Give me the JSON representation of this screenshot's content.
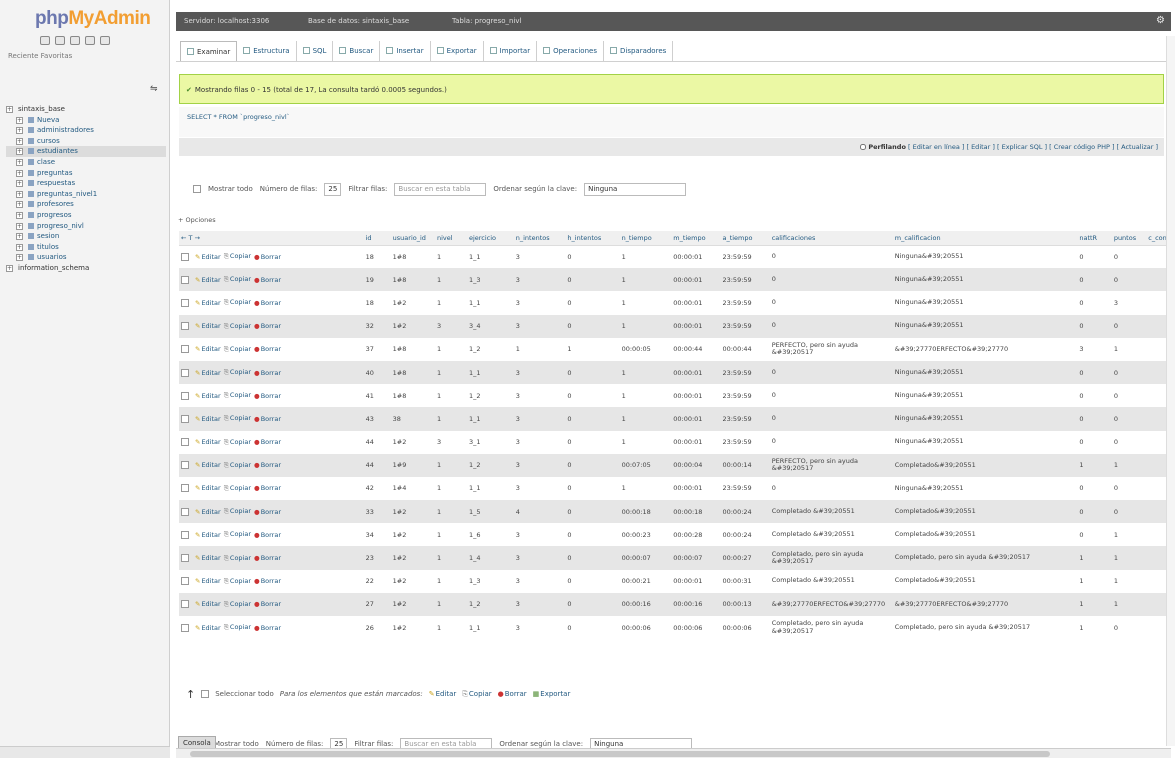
{
  "nav": {
    "logo_php": "php",
    "logo_my": "MyAdmin",
    "recent_label": "Reciente   Favoritas",
    "collapse_icon": "link-icon",
    "tree": [
      {
        "label": "sintaxis_base",
        "kind": "db",
        "selected": false
      },
      {
        "label": "Nueva",
        "kind": "tbl",
        "selected": false
      },
      {
        "label": "administradores",
        "kind": "tbl",
        "selected": false
      },
      {
        "label": "cursos",
        "kind": "tbl",
        "selected": false
      },
      {
        "label": "estudiantes",
        "kind": "tbl",
        "selected": true
      },
      {
        "label": "clase",
        "kind": "tbl",
        "selected": false
      },
      {
        "label": "preguntas",
        "kind": "tbl",
        "selected": false
      },
      {
        "label": "respuestas",
        "kind": "tbl",
        "selected": false
      },
      {
        "label": "preguntas_nivel1",
        "kind": "tbl",
        "selected": false
      },
      {
        "label": "profesores",
        "kind": "tbl",
        "selected": false
      },
      {
        "label": "progresos",
        "kind": "tbl",
        "selected": false
      },
      {
        "label": "progreso_nivl",
        "kind": "tbl",
        "selected": false
      },
      {
        "label": "sesion",
        "kind": "tbl",
        "selected": false
      },
      {
        "label": "titulos",
        "kind": "tbl",
        "selected": false
      },
      {
        "label": "usuarios",
        "kind": "tbl",
        "selected": false
      },
      {
        "label": "information_schema",
        "kind": "db",
        "selected": false
      }
    ]
  },
  "topbar": {
    "crumbs": [
      "Servidor: localhost:3306",
      "Base de datos: sintaxis_base",
      "Tabla: progreso_nivl"
    ],
    "gear_icon": "gear-icon"
  },
  "tabs": [
    "Examinar",
    "Estructura",
    "SQL",
    "Buscar",
    "Insertar",
    "Exportar",
    "Importar",
    "Operaciones",
    "Disparadores"
  ],
  "success_message": "Mostrando filas 0 - 15 (total de 17, La consulta tardó 0.0005 segundos.)",
  "sql_query": "SELECT * FROM `progreso_nivl`",
  "profiling": {
    "label": "Perfilando",
    "links": "[ Editar en línea ] [ Editar ] [ Explicar SQL ] [ Crear código PHP ] [ Actualizar ]"
  },
  "toolbar": {
    "show_all": "Mostrar todo",
    "rows_label": "Número de filas:",
    "rows_value": "25",
    "filter_label": "Filtrar filas:",
    "filter_placeholder": "Buscar en esta tabla",
    "sort_label": "Ordenar según la clave:",
    "sort_value": "Ninguna"
  },
  "options_label": "+ Opciones",
  "grid": {
    "columns": [
      "id",
      "usuario_id",
      "nivel",
      "ejercicio",
      "n_intentos",
      "h_intentos",
      "n_tiempo",
      "m_tiempo",
      "a_tiempo",
      "calificaciones",
      "m_calificacion",
      "nattR",
      "puntos",
      "c_conn"
    ],
    "actions": {
      "edit": "Editar",
      "copy": "Copiar",
      "delete": "Borrar"
    },
    "rows": [
      [
        "18",
        "1#8",
        "1",
        "1_1",
        "3",
        "0",
        "1",
        "00:00:01",
        "23:59:59",
        "0",
        "Ninguna&#39;20551",
        "0",
        "0"
      ],
      [
        "19",
        "1#8",
        "1",
        "1_3",
        "3",
        "0",
        "1",
        "00:00:01",
        "23:59:59",
        "0",
        "Ninguna&#39;20551",
        "0",
        "0"
      ],
      [
        "18",
        "1#2",
        "1",
        "1_1",
        "3",
        "0",
        "1",
        "00:00:01",
        "23:59:59",
        "0",
        "Ninguna&#39;20551",
        "0",
        "3"
      ],
      [
        "32",
        "1#2",
        "3",
        "3_4",
        "3",
        "0",
        "1",
        "00:00:01",
        "23:59:59",
        "0",
        "Ninguna&#39;20551",
        "0",
        "0"
      ],
      [
        "37",
        "1#8",
        "1",
        "1_2",
        "1",
        "1",
        "00:00:05",
        "00:00:44",
        "00:00:44",
        "PERFECTO, pero sin ayuda &#39;20517",
        "&#39;27770ERFECTO&#39;27770",
        "3",
        "1"
      ],
      [
        "40",
        "1#8",
        "1",
        "1_1",
        "3",
        "0",
        "1",
        "00:00:01",
        "23:59:59",
        "0",
        "Ninguna&#39;20551",
        "0",
        "0"
      ],
      [
        "41",
        "1#8",
        "1",
        "1_2",
        "3",
        "0",
        "1",
        "00:00:01",
        "23:59:59",
        "0",
        "Ninguna&#39;20551",
        "0",
        "0"
      ],
      [
        "43",
        "38",
        "1",
        "1_1",
        "3",
        "0",
        "1",
        "00:00:01",
        "23:59:59",
        "0",
        "Ninguna&#39;20551",
        "0",
        "0"
      ],
      [
        "44",
        "1#2",
        "3",
        "3_1",
        "3",
        "0",
        "1",
        "00:00:01",
        "23:59:59",
        "0",
        "Ninguna&#39;20551",
        "0",
        "0"
      ],
      [
        "44",
        "1#9",
        "1",
        "1_2",
        "3",
        "0",
        "00:07:05",
        "00:00:04",
        "00:00:14",
        "PERFECTO, pero sin ayuda &#39;20517",
        "Completado&#39;20551",
        "1",
        "1"
      ],
      [
        "42",
        "1#4",
        "1",
        "1_1",
        "3",
        "0",
        "1",
        "00:00:01",
        "23:59:59",
        "0",
        "Ninguna&#39;20551",
        "0",
        "0"
      ],
      [
        "33",
        "1#2",
        "1",
        "1_5",
        "4",
        "0",
        "00:00:18",
        "00:00:18",
        "00:00:24",
        "Completado &#39;20551",
        "Completado&#39;20551",
        "0",
        "0"
      ],
      [
        "34",
        "1#2",
        "1",
        "1_6",
        "3",
        "0",
        "00:00:23",
        "00:00:28",
        "00:00:24",
        "Completado &#39;20551",
        "Completado&#39;20551",
        "0",
        "1"
      ],
      [
        "23",
        "1#2",
        "1",
        "1_4",
        "3",
        "0",
        "00:00:07",
        "00:00:07",
        "00:00:27",
        "Completado, pero sin ayuda &#39;20517",
        "Completado, pero sin ayuda &#39;20517",
        "1",
        "1"
      ],
      [
        "22",
        "1#2",
        "1",
        "1_3",
        "3",
        "0",
        "00:00:21",
        "00:00:01",
        "00:00:31",
        "Completado &#39;20551",
        "Completado&#39;20551",
        "1",
        "1"
      ],
      [
        "27",
        "1#2",
        "1",
        "1_2",
        "3",
        "0",
        "00:00:16",
        "00:00:16",
        "00:00:13",
        "&#39;27770ERFECTO&#39;27770",
        "&#39;27770ERFECTO&#39;27770",
        "1",
        "1"
      ],
      [
        "26",
        "1#2",
        "1",
        "1_1",
        "3",
        "0",
        "00:00:06",
        "00:00:06",
        "00:00:06",
        "Completado, pero sin ayuda &#39;20517",
        "Completado, pero sin ayuda &#39;20517",
        "1",
        "0"
      ]
    ]
  },
  "bulk": {
    "select_all": "Seleccionar todo",
    "with_selected": "Para los elementos que están marcados:",
    "edit": "Editar",
    "copy": "Copiar",
    "delete": "Borrar",
    "export": "Exportar"
  },
  "console_label": "Consola"
}
